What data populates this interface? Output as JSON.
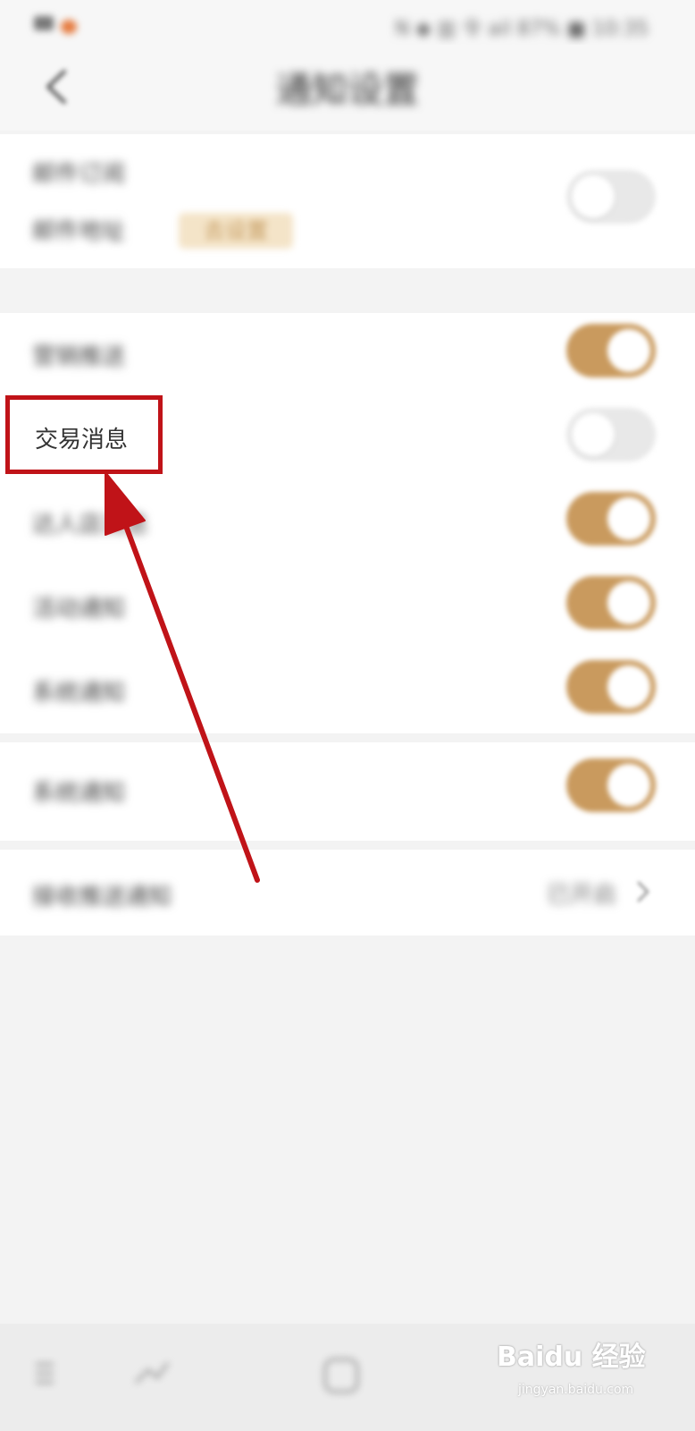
{
  "status_bar": {
    "left_text": "",
    "right_text": "N ◆ ▥ 令 ail 87% ■ 10:35"
  },
  "header": {
    "title": "通知设置",
    "back_icon": "chevron-left-icon"
  },
  "sections": {
    "email": {
      "row1_label": "邮件订阅",
      "row2_label": "邮件地址",
      "link_label": "去设置",
      "toggle_on": false
    },
    "messages": [
      {
        "label": "营销推送",
        "on": true
      },
      {
        "label": "交易消息",
        "on": false
      },
      {
        "label": "达人店消息",
        "on": true
      },
      {
        "label": "活动通知",
        "on": true
      },
      {
        "label": "系统通知",
        "on": true
      }
    ],
    "extra": {
      "label": "系统通知",
      "on": true
    },
    "system_push": {
      "label": "接收推送通知",
      "value": "已开启"
    }
  },
  "annotation": {
    "highlight_label": "交易消息",
    "color": "#c01318"
  },
  "colors": {
    "accent": "#c99a5e",
    "toggle_off": "#e8e8e8",
    "background": "#f3f3f3"
  },
  "bottom_bar": {
    "icons": [
      "menu-icon",
      "recent-apps-icon",
      "home-icon"
    ],
    "watermark_logo": "Baidu 经验",
    "watermark_url": "jingyan.baidu.com"
  }
}
